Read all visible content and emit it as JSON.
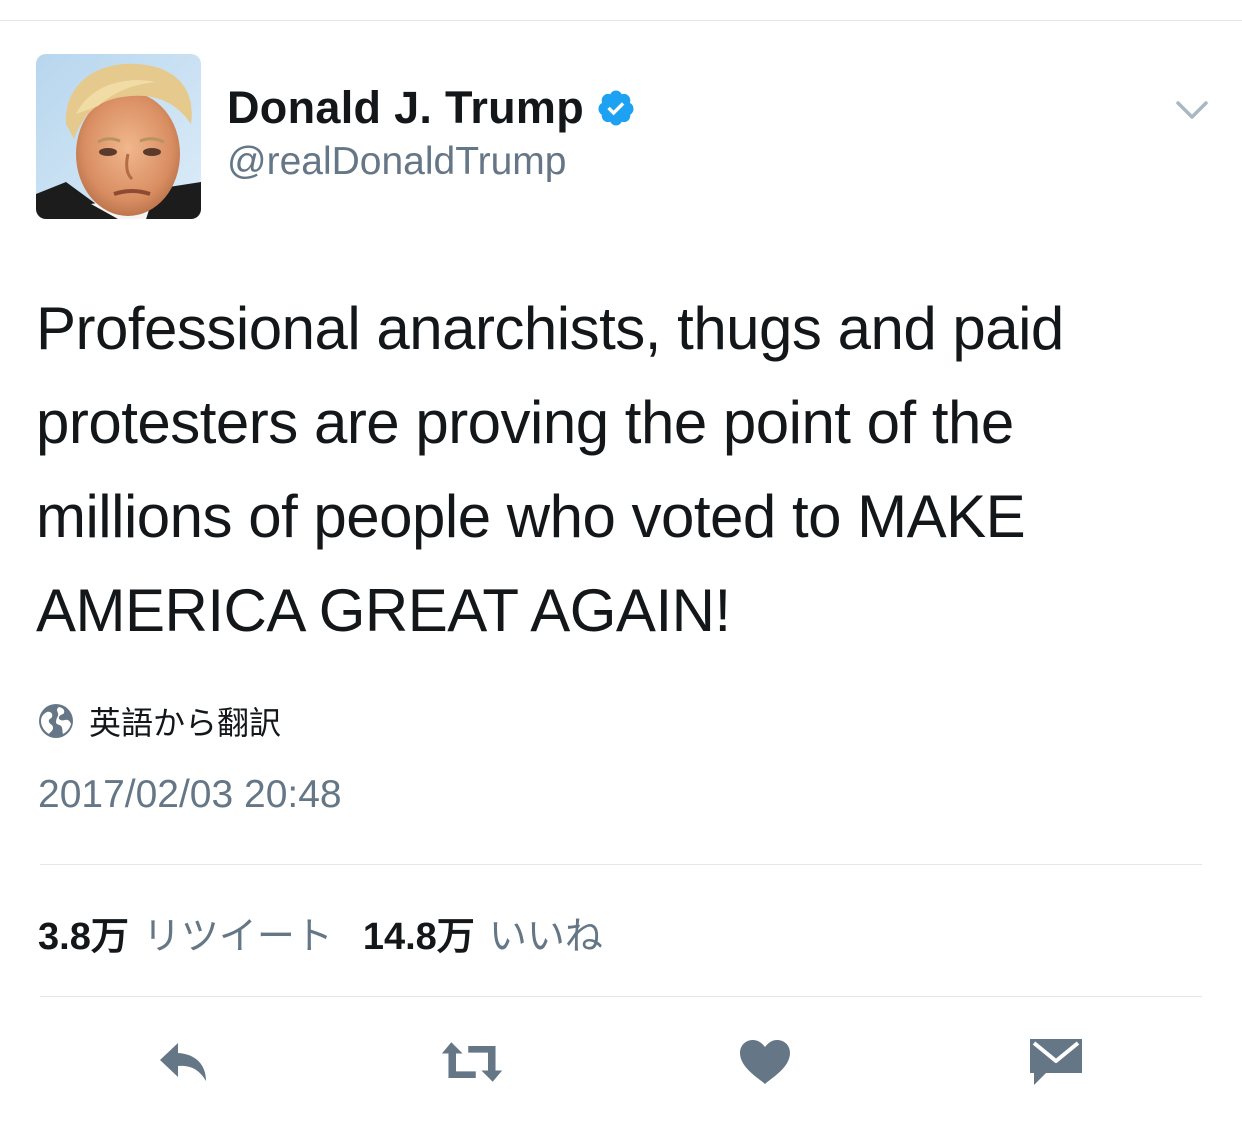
{
  "user": {
    "display_name": "Donald J. Trump",
    "handle": "@realDonaldTrump",
    "verified": true
  },
  "tweet": {
    "lines": [
      "Professional anarchists, thugs and paid",
      "protesters are proving the point of the",
      "millions of people who voted to MAKE",
      "AMERICA GREAT AGAIN!"
    ],
    "translate_label": "英語から翻訳",
    "timestamp": "2017/02/03 20:48"
  },
  "stats": {
    "retweets_count": "3.8万",
    "retweets_label": "リツイート",
    "likes_count": "14.8万",
    "likes_label": "いいね"
  },
  "icons": {
    "verified": "verified-badge-icon",
    "caret": "chevron-down-icon",
    "translate": "globe-icon",
    "reply": "reply-icon",
    "retweet": "retweet-icon",
    "like": "heart-icon",
    "dm": "envelope-icon"
  },
  "colors": {
    "accent": "#1da1f2",
    "text_primary": "#14171a",
    "text_secondary": "#657786",
    "icon": "#657786",
    "divider": "#e1e8ed"
  }
}
